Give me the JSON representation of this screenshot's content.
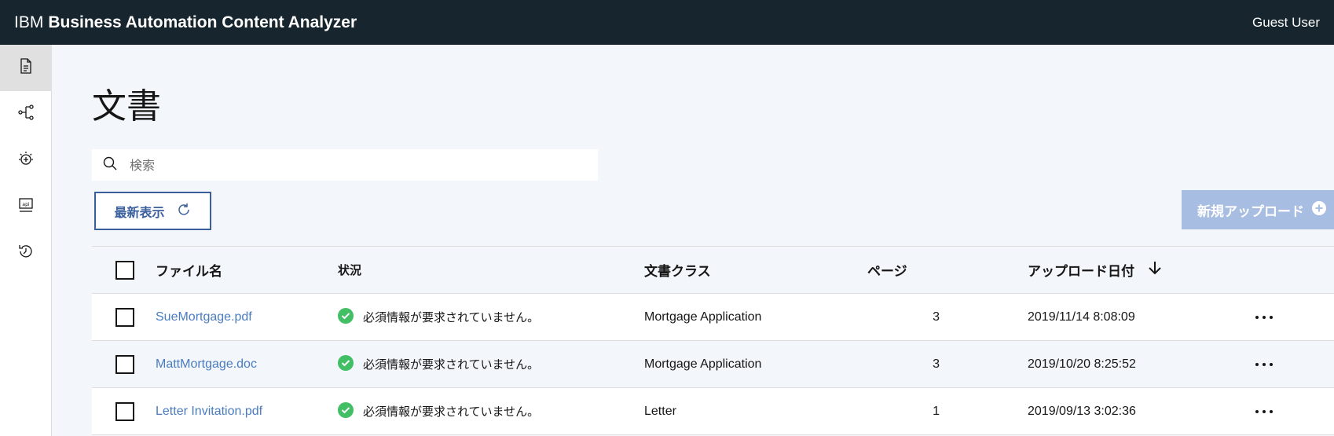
{
  "header": {
    "brand_ibm": "IBM",
    "brand_product": "Business Automation Content Analyzer",
    "user": "Guest User"
  },
  "sidebar": {
    "items": [
      {
        "icon": "document-icon",
        "active": true
      },
      {
        "icon": "flow-icon",
        "active": false
      },
      {
        "icon": "watson-icon",
        "active": false
      },
      {
        "icon": "api-icon",
        "active": false
      },
      {
        "icon": "history-icon",
        "active": false
      }
    ]
  },
  "page": {
    "title": "文書"
  },
  "search": {
    "placeholder": "検索",
    "value": ""
  },
  "actions": {
    "refresh_label": "最新表示",
    "upload_label": "新規アップロード"
  },
  "table": {
    "columns": {
      "name": "ファイル名",
      "status": "状況",
      "class": "文書クラス",
      "pages": "ページ",
      "date": "アップロード日付"
    },
    "rows": [
      {
        "name": "SueMortgage.pdf",
        "status": "必須情報が要求されていません。",
        "class": "Mortgage Application",
        "pages": "3",
        "date": "2019/11/14 8:08:09"
      },
      {
        "name": "MattMortgage.doc",
        "status": "必須情報が要求されていません。",
        "class": "Mortgage Application",
        "pages": "3",
        "date": "2019/10/20 8:25:52"
      },
      {
        "name": "Letter Invitation.pdf",
        "status": "必須情報が要求されていません。",
        "class": "Letter",
        "pages": "1",
        "date": "2019/09/13 3:02:36"
      }
    ]
  },
  "colors": {
    "topbar": "#17262e",
    "link": "#4a7cbf",
    "success": "#42be65",
    "upload_disabled": "#a7bde1"
  }
}
